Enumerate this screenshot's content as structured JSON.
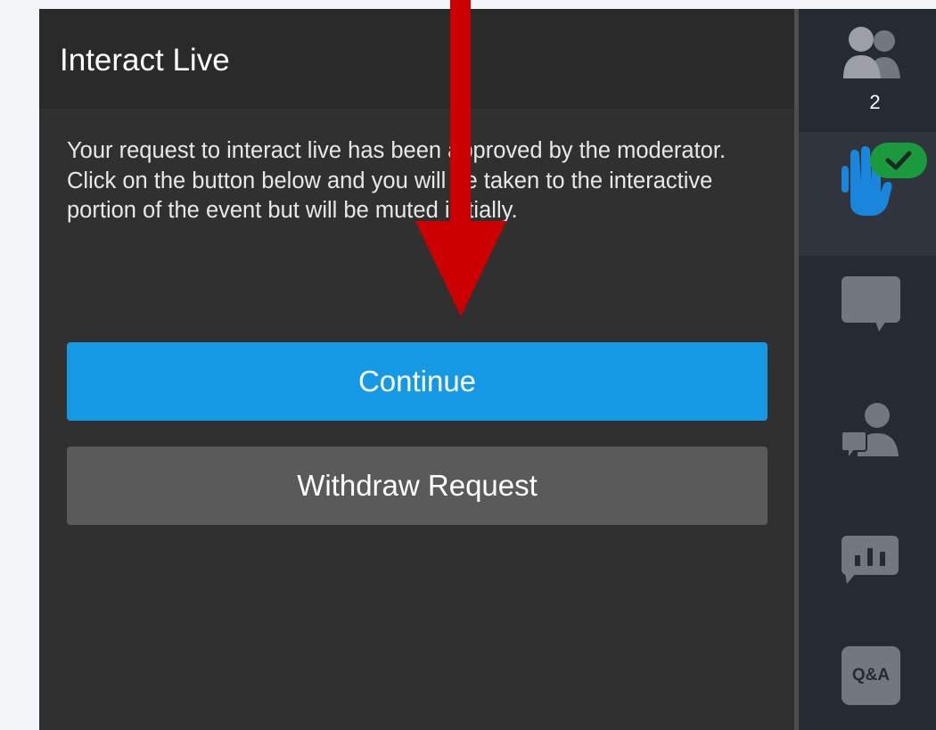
{
  "panel": {
    "title": "Interact Live",
    "message": "Your request to interact live has been approved by the moderator. Click on the button below and you will be taken to the interactive portion of the event but will be muted initially.",
    "continue_label": "Continue",
    "withdraw_label": "Withdraw Request"
  },
  "sidebar": {
    "participants_count": "2",
    "qa_label": "Q&A",
    "items": [
      {
        "icon": "participants-icon"
      },
      {
        "icon": "raise-hand-icon",
        "active": true,
        "badge": "check-icon"
      },
      {
        "icon": "chat-icon"
      },
      {
        "icon": "presenter-chat-icon"
      },
      {
        "icon": "poll-icon"
      },
      {
        "icon": "qa-icon"
      }
    ]
  },
  "colors": {
    "accent_blue": "#1699e4",
    "withdraw_gray": "#5a5a5a",
    "panel_bg": "#303030",
    "sidebar_bg": "#262a33",
    "badge_green": "#1a9a3c",
    "arrow_red": "#cc0000"
  }
}
